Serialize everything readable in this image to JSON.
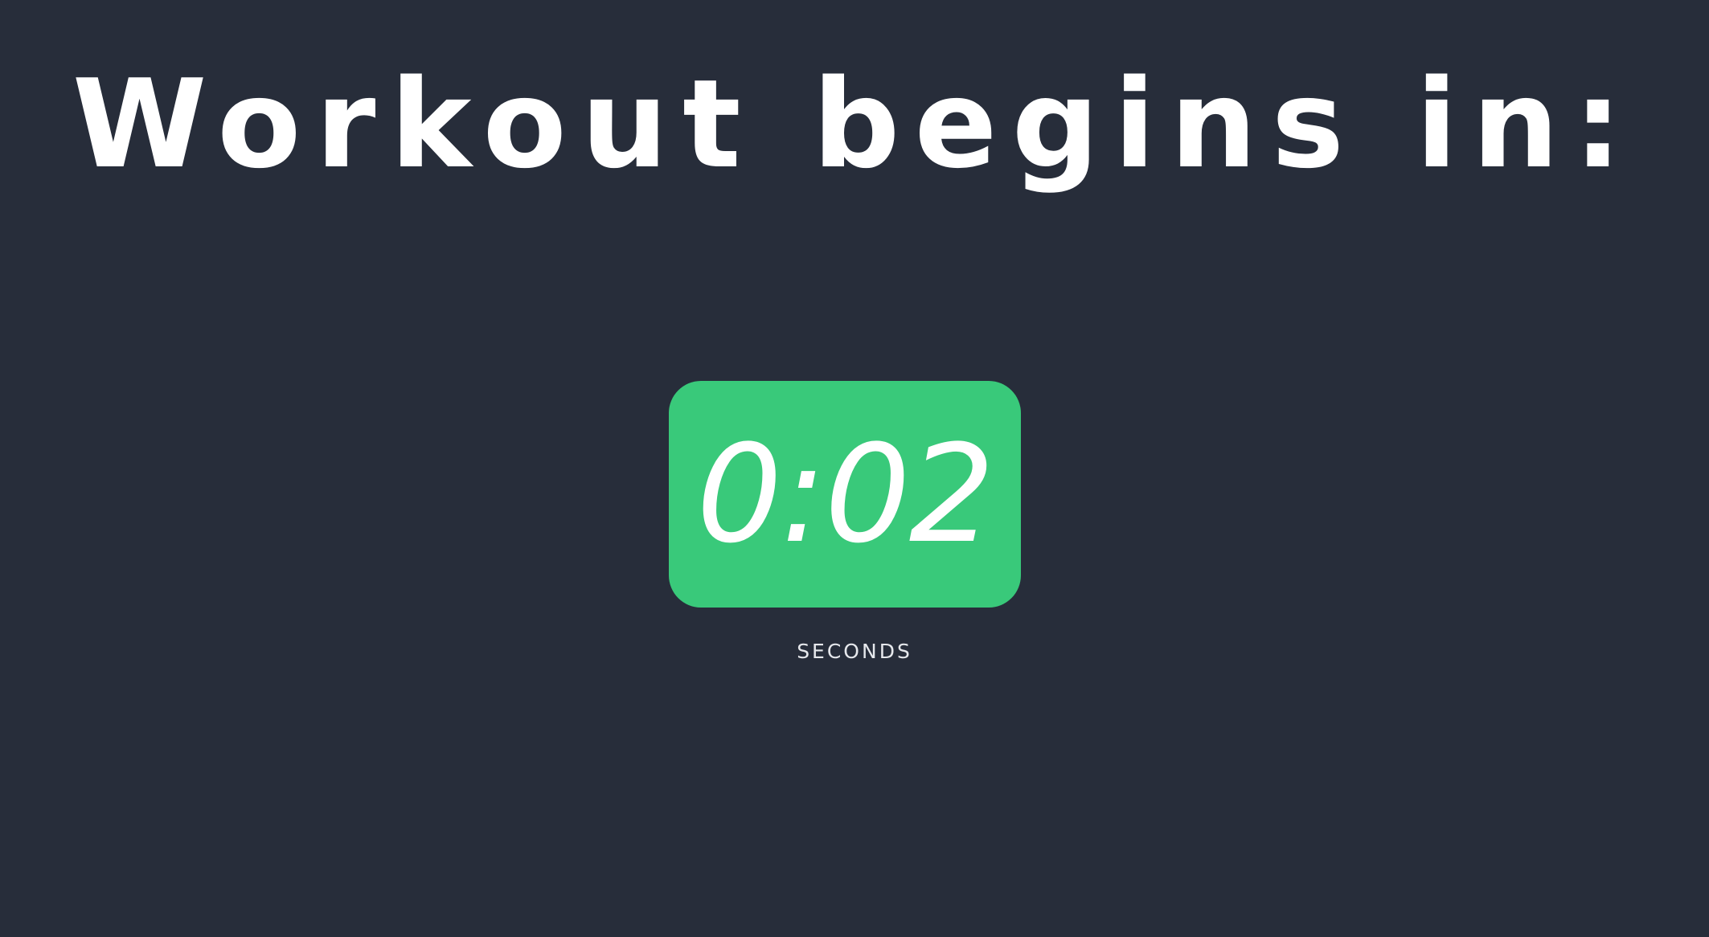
{
  "header": {
    "title": "Workout begins in:"
  },
  "countdown": {
    "display": "0:02",
    "remaining_seconds": 2,
    "unit_label": "SECONDS"
  },
  "colors": {
    "background": "#272d3a",
    "timer_accent": "#39c97a",
    "text": "#ffffff"
  }
}
